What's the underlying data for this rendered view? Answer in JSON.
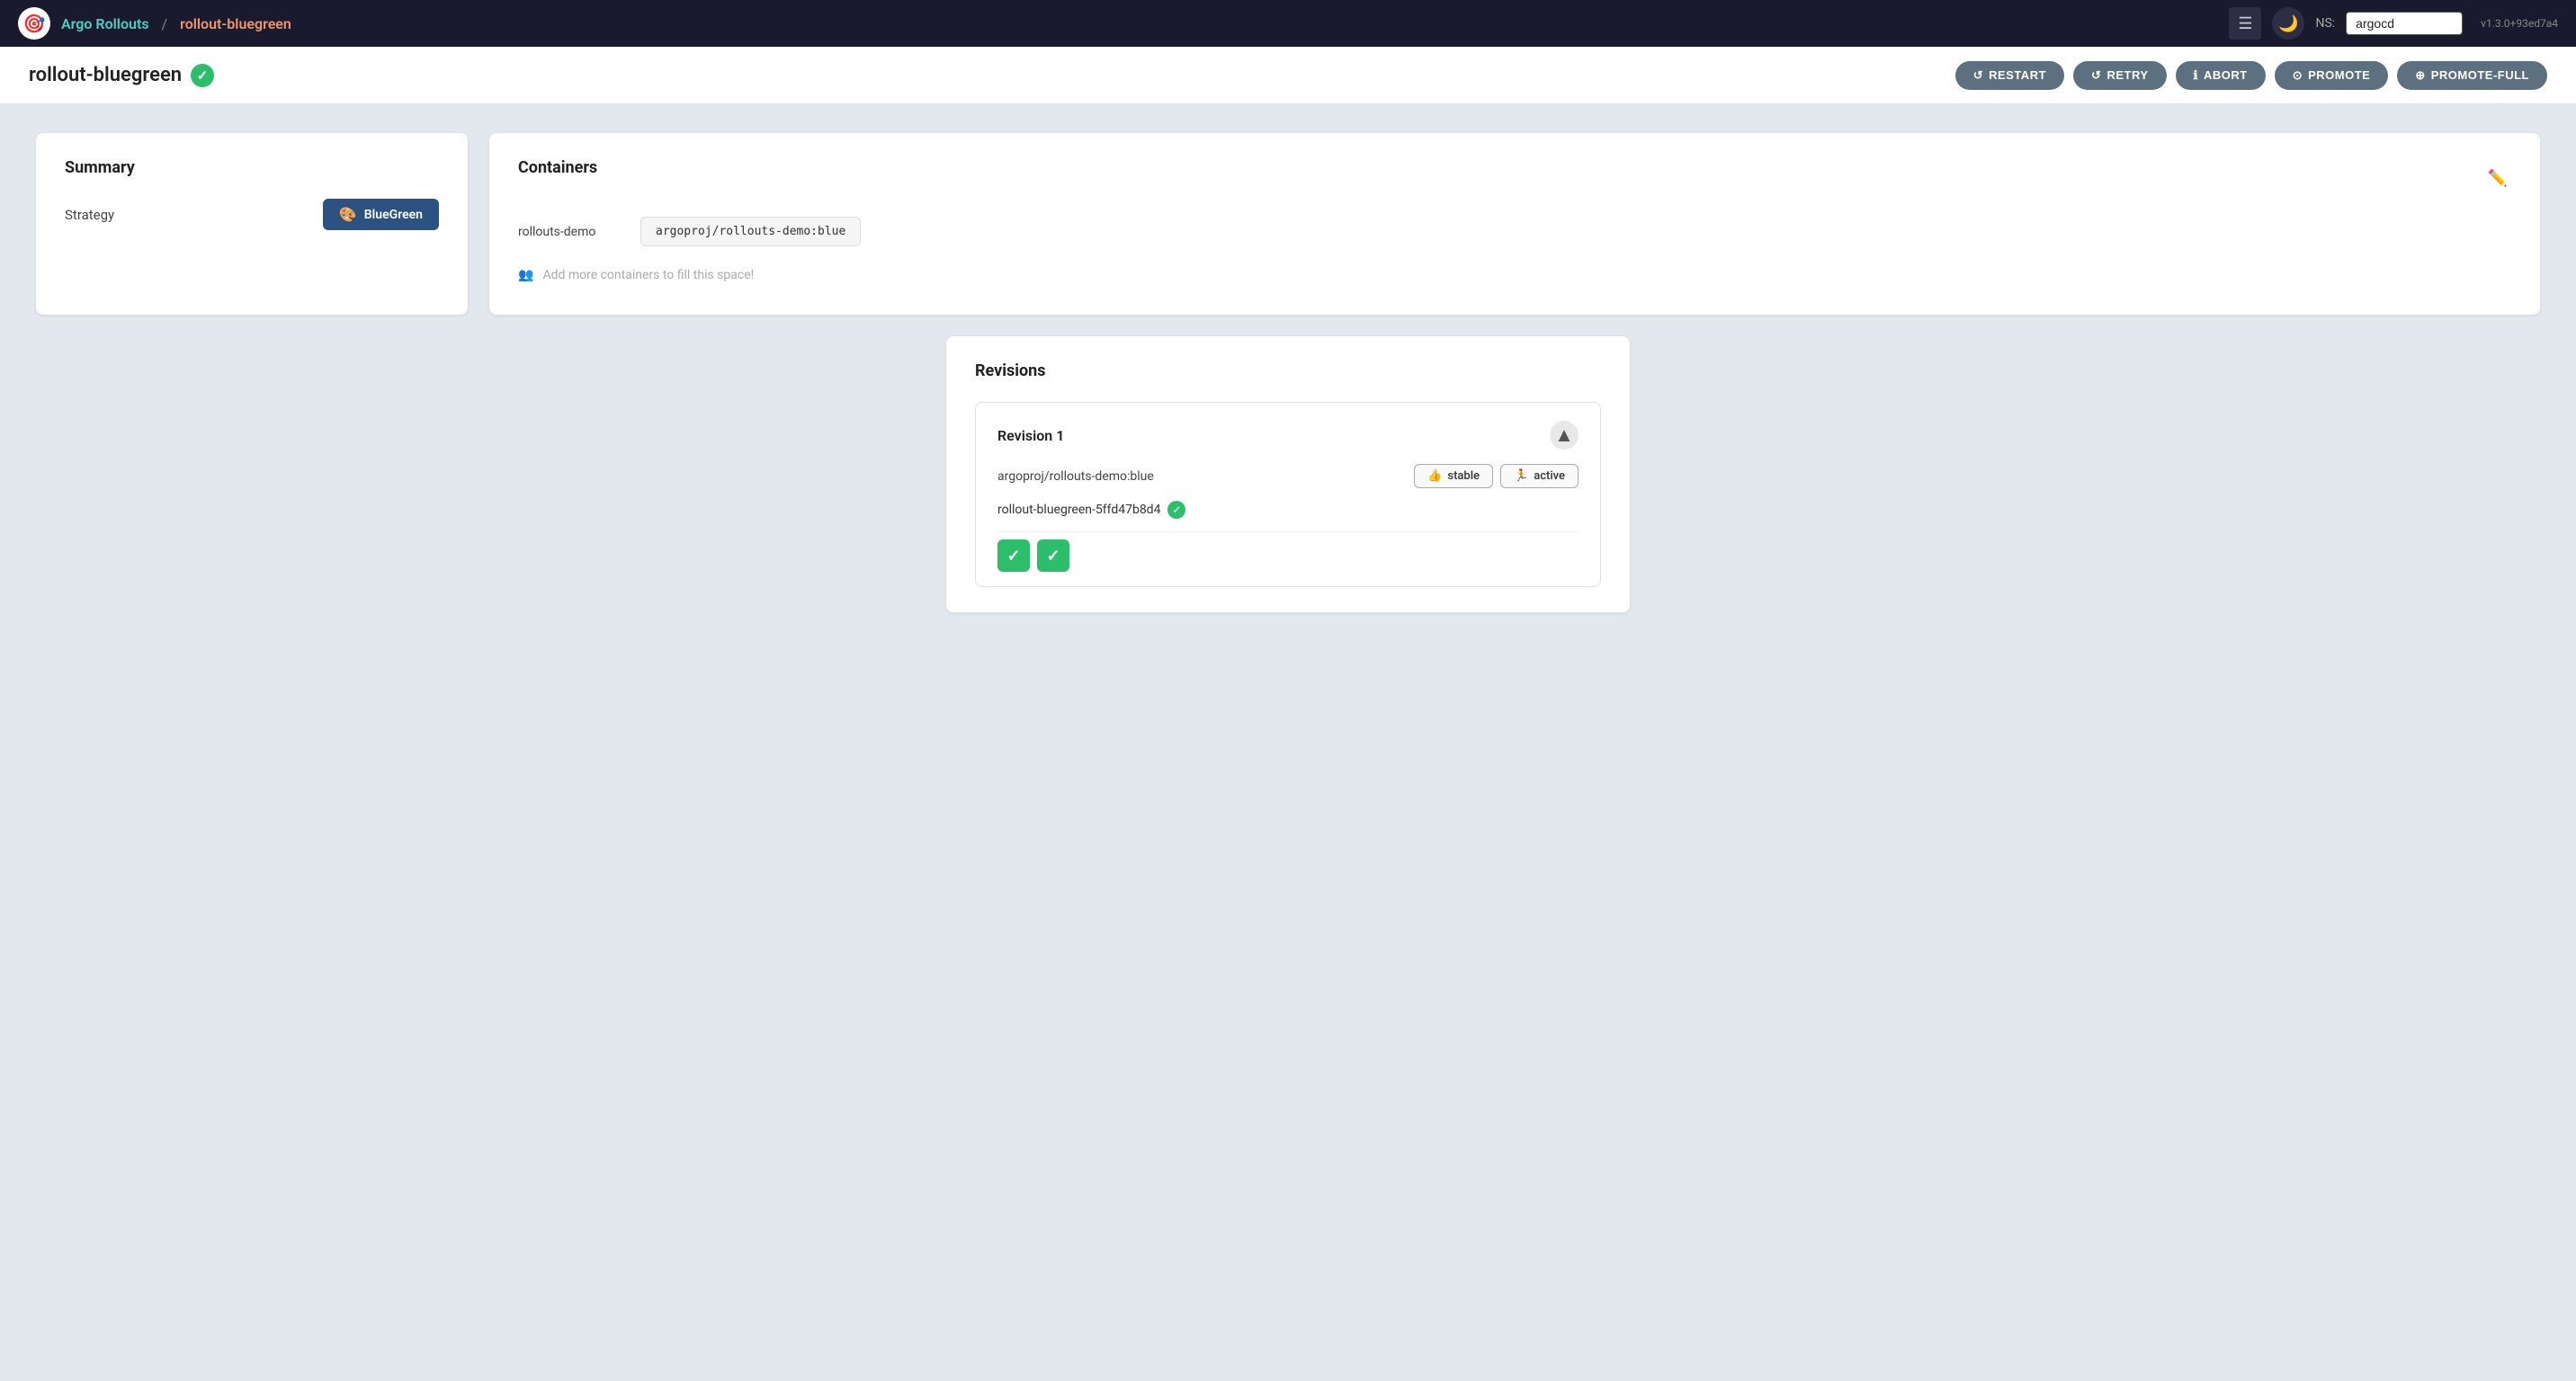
{
  "header": {
    "app_name": "Argo Rollouts",
    "separator": "/",
    "rollout_name": "rollout-bluegreen",
    "ns_label": "NS:",
    "ns_value": "argocd",
    "version": "v1.3.0+93ed7a4"
  },
  "subheader": {
    "title": "rollout-bluegreen",
    "actions": {
      "restart": "RESTART",
      "retry": "RETRY",
      "abort": "ABORT",
      "promote": "PROMOTE",
      "promote_full": "PROMOTE-FULL"
    }
  },
  "summary": {
    "title": "Summary",
    "strategy_label": "Strategy",
    "strategy_value": "BlueGreen"
  },
  "containers": {
    "title": "Containers",
    "container_name": "rollouts-demo",
    "container_image": "argoproj/rollouts-demo:blue",
    "add_placeholder": "Add more containers to fill this space!"
  },
  "revisions": {
    "title": "Revisions",
    "items": [
      {
        "title": "Revision 1",
        "image": "argoproj/rollouts-demo:blue",
        "badges": [
          {
            "label": "stable",
            "icon": "👍"
          },
          {
            "label": "active",
            "icon": "🏃"
          }
        ],
        "replicaset": "rollout-bluegreen-5ffd47b8d4",
        "pods": [
          {
            "status": "success"
          },
          {
            "status": "success"
          }
        ]
      }
    ]
  }
}
